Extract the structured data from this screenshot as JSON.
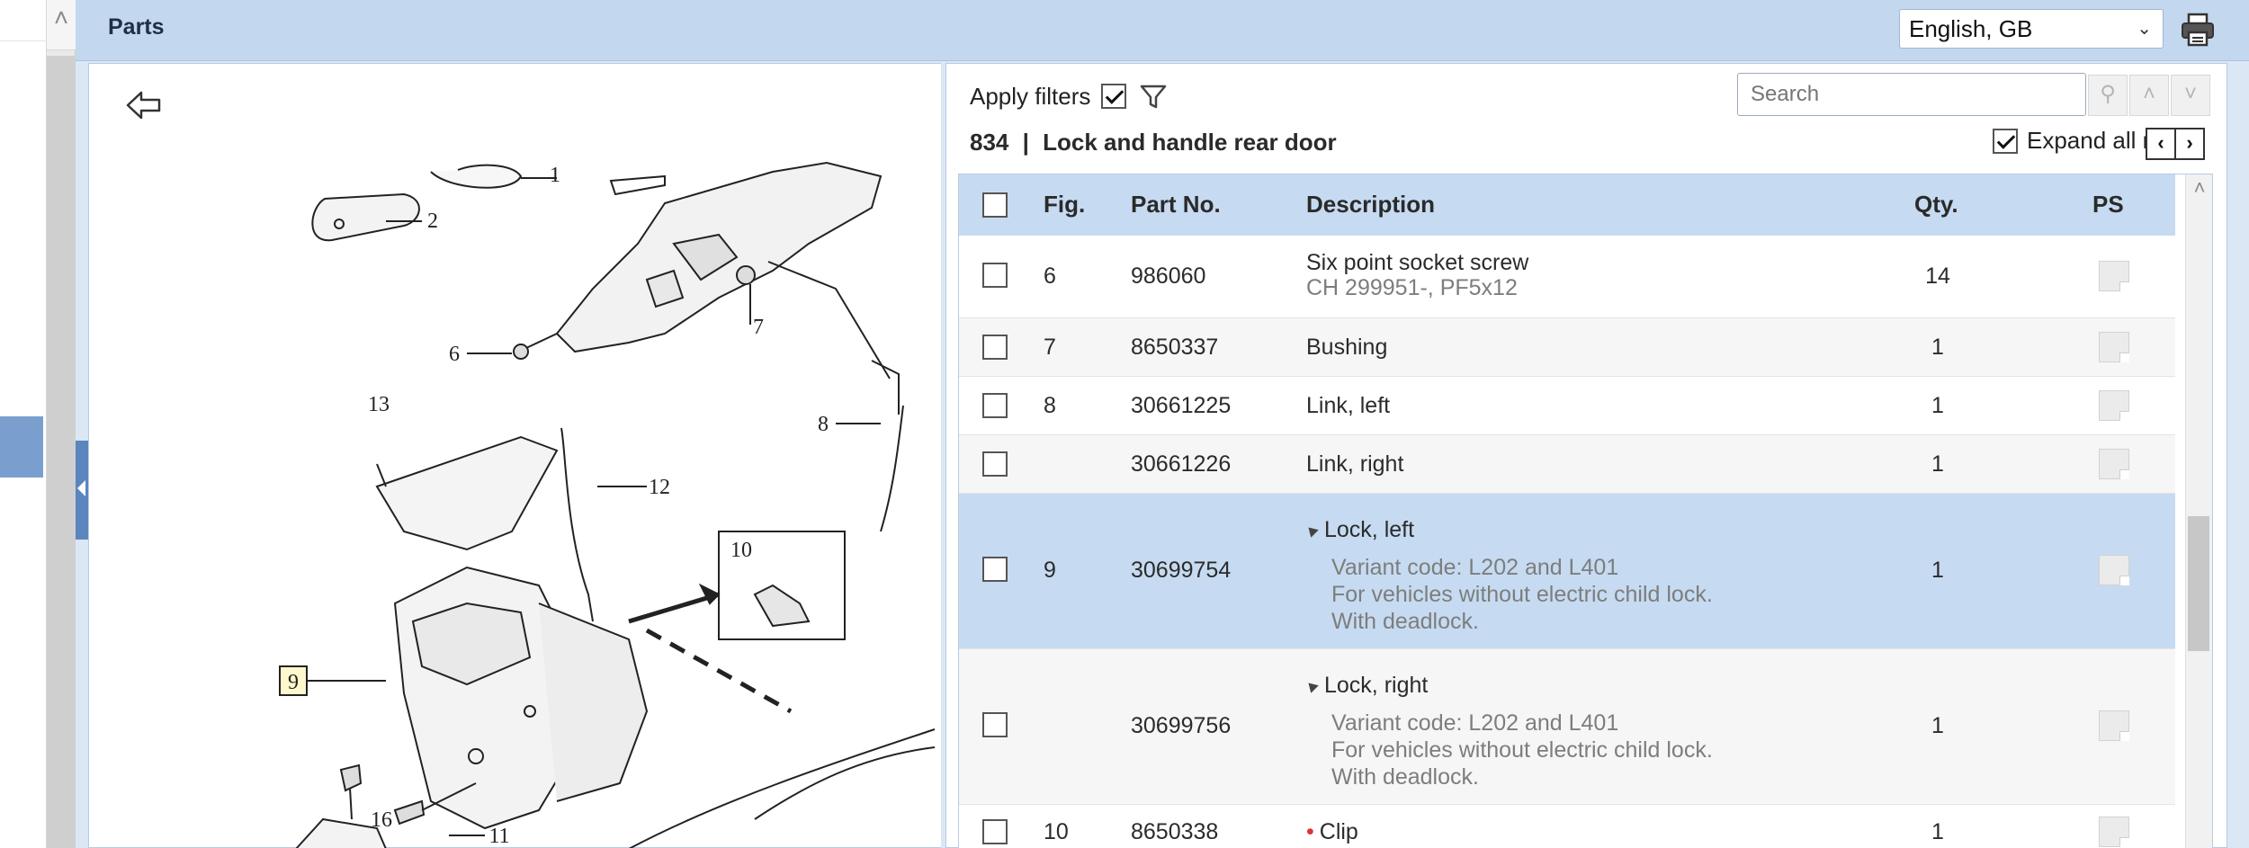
{
  "window": {
    "title": "Parts"
  },
  "language": {
    "selected": "English, GB"
  },
  "filters": {
    "apply_label": "Apply filters",
    "apply_checked": true
  },
  "search": {
    "placeholder": "Search"
  },
  "heading": {
    "group": "834",
    "separator": "|",
    "name": "Lock and handle rear door"
  },
  "expand": {
    "label": "Expand all notes",
    "checked": true
  },
  "table": {
    "headers": {
      "fig": "Fig.",
      "part": "Part No.",
      "desc": "Description",
      "qty": "Qty.",
      "ps": "PS"
    },
    "rows": [
      {
        "fig": "6",
        "part": "986060",
        "desc": "Six point socket screw",
        "notes": [
          "CH 299951-, PF5x12"
        ],
        "qty": "14"
      },
      {
        "fig": "7",
        "part": "8650337",
        "desc": "Bushing",
        "notes": [],
        "qty": "1"
      },
      {
        "fig": "8",
        "part": "30661225",
        "desc": "Link, left",
        "notes": [],
        "qty": "1"
      },
      {
        "fig": "",
        "part": "30661226",
        "desc": "Link, right",
        "notes": [],
        "qty": "1"
      },
      {
        "fig": "9",
        "part": "30699754",
        "desc": "Lock, left",
        "notes": [
          "Variant code: L202 and L401",
          "For vehicles without electric child lock.",
          "With deadlock."
        ],
        "qty": "1",
        "selected": true
      },
      {
        "fig": "",
        "part": "30699756",
        "desc": "Lock, right",
        "notes": [
          "Variant code: L202 and L401",
          "For vehicles without electric child lock.",
          "With deadlock."
        ],
        "qty": "1"
      },
      {
        "fig": "10",
        "part": "8650338",
        "desc": "Clip",
        "notes": [],
        "qty": "1",
        "bullet": "•"
      }
    ]
  },
  "illustration": {
    "callouts": [
      "1",
      "2",
      "6",
      "7",
      "8",
      "13",
      "12",
      "10",
      "9",
      "16",
      "11"
    ]
  }
}
